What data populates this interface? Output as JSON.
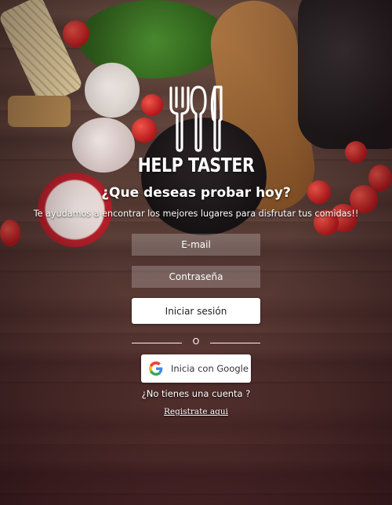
{
  "brand": {
    "name": "HELP TASTER",
    "logo_icon": "utensils-icon"
  },
  "hero": {
    "headline": "¿Que deseas probar hoy?",
    "subline": "Te ayudamos a encontrar los mejores lugares para disfrutar tus comidas!!"
  },
  "form": {
    "email_placeholder": "E-mail",
    "password_placeholder": "Contraseña",
    "login_label": "Iniciar sesión",
    "divider_label": "O",
    "google_label": "Inicia con Google",
    "google_icon": "google-icon"
  },
  "footer": {
    "no_account_text": "¿No tienes una cuenta ?",
    "register_link": "Registrate aqui"
  },
  "colors": {
    "text": "#ffffff",
    "button_bg": "#ffffff",
    "field_bg": "rgba(255,255,255,0.22)"
  }
}
